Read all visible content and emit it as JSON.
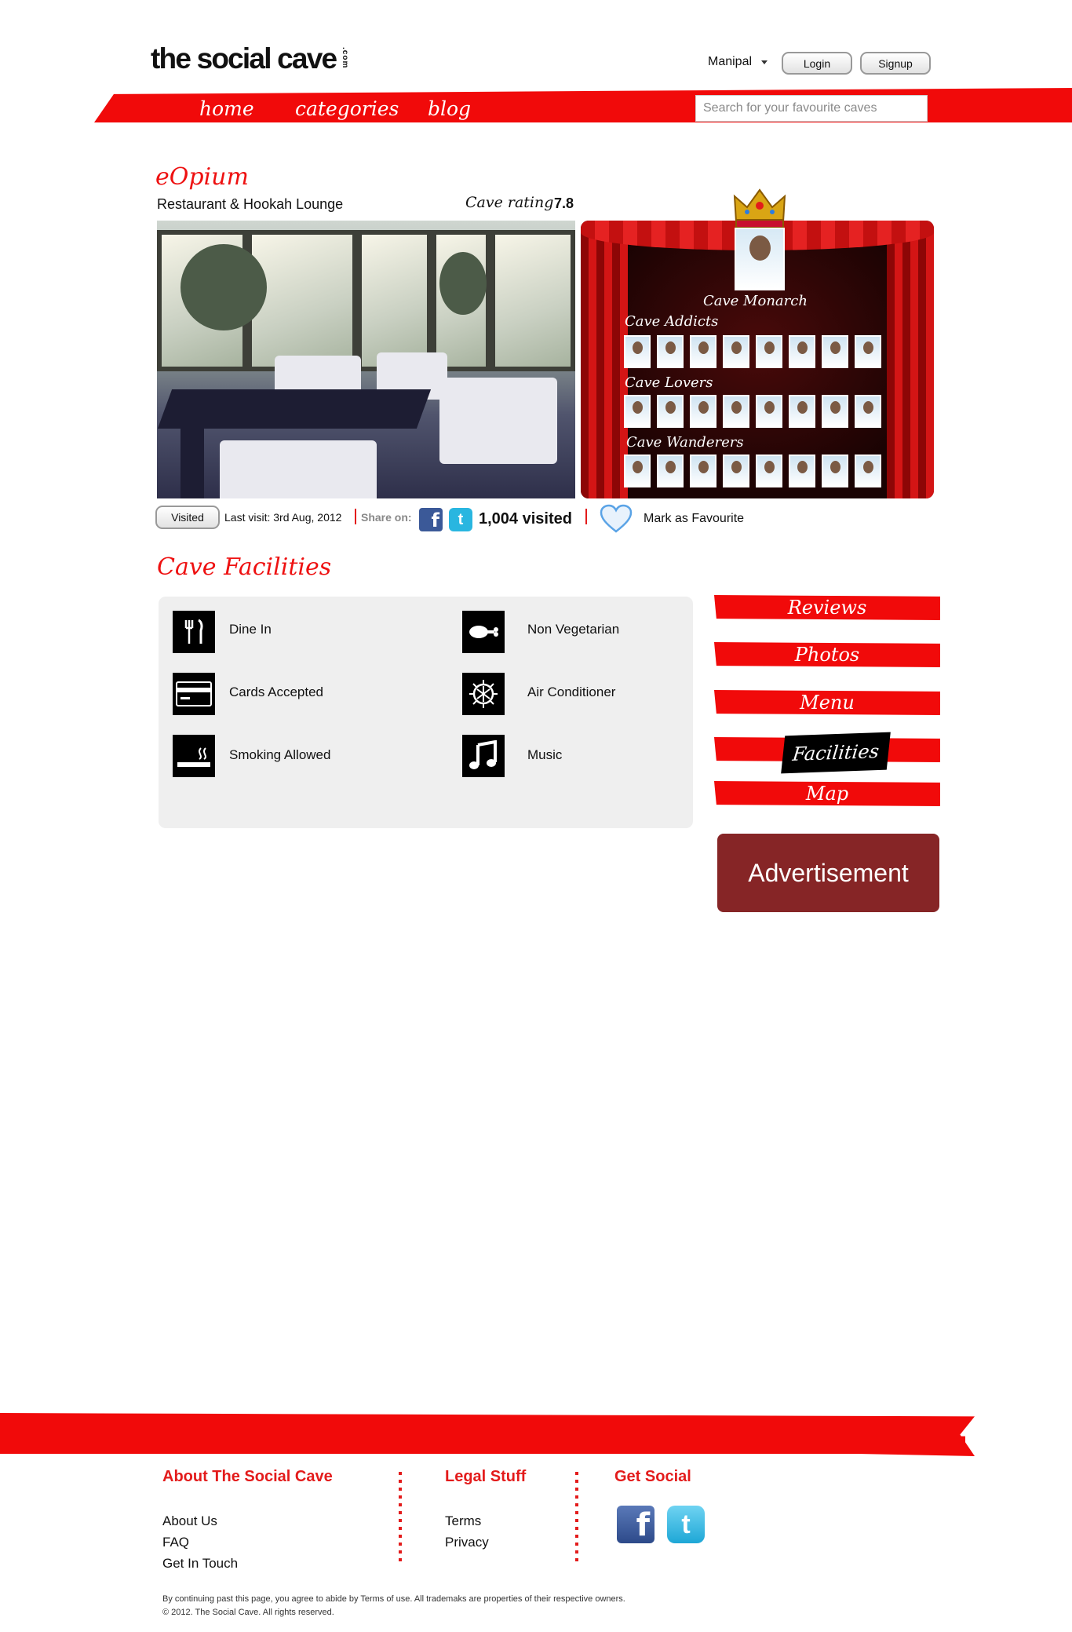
{
  "header": {
    "logo": "the social cave",
    "logo_suffix": ".com",
    "city": "Manipal",
    "login_label": "Login",
    "signup_label": "Signup"
  },
  "nav": {
    "items": [
      {
        "label": "home"
      },
      {
        "label": "categories"
      },
      {
        "label": "blog"
      }
    ],
    "search_placeholder": "Search for your favourite caves"
  },
  "venue": {
    "name": "eOpium",
    "type": "Restaurant & Hookah Lounge",
    "rating_label": "Cave rating",
    "rating_value": "7.8"
  },
  "stage": {
    "monarch_label": "Cave Monarch",
    "addicts_label": "Cave Addicts",
    "lovers_label": "Cave Lovers",
    "wanderers_label": "Cave Wanderers"
  },
  "actions": {
    "visited_label": "Visited",
    "last_visit": "Last visit: 3rd Aug, 2012",
    "share_label": "Share on:",
    "visited_count": "1,004 visited",
    "favourite_label": "Mark as Favourite"
  },
  "facilities": {
    "title": "Cave Facilities",
    "items": [
      {
        "label": "Dine In",
        "icon": "fork-knife-icon"
      },
      {
        "label": "Non Vegetarian",
        "icon": "drumstick-icon"
      },
      {
        "label": "Cards Accepted",
        "icon": "credit-card-icon"
      },
      {
        "label": "Air Conditioner",
        "icon": "sun-snowflake-icon"
      },
      {
        "label": "Smoking Allowed",
        "icon": "cigarette-icon"
      },
      {
        "label": "Music",
        "icon": "music-note-icon"
      }
    ]
  },
  "sidebar": {
    "tabs": [
      {
        "label": "Reviews"
      },
      {
        "label": "Photos"
      },
      {
        "label": "Menu"
      },
      {
        "label": "Facilities",
        "active": true
      },
      {
        "label": "Map"
      }
    ],
    "ad_label": "Advertisement"
  },
  "footer": {
    "about": {
      "title": "About The Social Cave",
      "links": [
        "About Us",
        "FAQ",
        "Get In Touch"
      ]
    },
    "legal": {
      "title": "Legal Stuff",
      "links": [
        "Terms",
        "Privacy"
      ]
    },
    "social": {
      "title": "Get Social"
    },
    "disclaimer": "By continuing past this page, you agree to abide by Terms of use. All trademaks are properties of their respective owners.",
    "copyright": "© 2012. The Social Cave. All rights reserved."
  },
  "colors": {
    "brand_red": "#f10a0a",
    "ad_bg": "#862526",
    "panel_bg": "#efefef"
  }
}
